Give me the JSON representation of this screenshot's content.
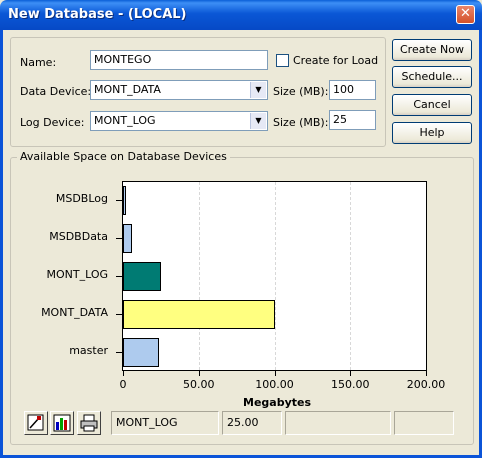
{
  "window": {
    "title": "New Database - (LOCAL)",
    "close_glyph": "✕"
  },
  "form": {
    "name_label": "Name:",
    "name_value": "MONTEGO",
    "create_for_load_label": "Create for Load",
    "create_for_load_checked": false,
    "data_device_label": "Data Device:",
    "data_device_value": "MONT_DATA",
    "log_device_label": "Log Device:",
    "log_device_value": "MONT_LOG",
    "size_label": "Size (MB):",
    "data_size_value": "100",
    "log_size_value": "25"
  },
  "buttons": {
    "create_now": "Create Now",
    "schedule": "Schedule...",
    "cancel": "Cancel",
    "help": "Help"
  },
  "available_space": {
    "title": "Available Space on Database Devices"
  },
  "chart_data": {
    "type": "bar",
    "orientation": "horizontal",
    "categories": [
      "MSDBLog",
      "MSDBData",
      "MONT_LOG",
      "MONT_DATA",
      "master"
    ],
    "values": [
      2,
      6,
      25,
      100,
      24
    ],
    "bar_colors": [
      "#aecbee",
      "#aecbee",
      "#007b73",
      "#ffff80",
      "#aecbee"
    ],
    "xlabel": "Megabytes",
    "xlim": [
      0,
      200
    ],
    "xticks": [
      "0",
      "50.00",
      "100.00",
      "150.00",
      "200.00"
    ],
    "grid": true
  },
  "status": {
    "device": "MONT_LOG",
    "size": "25.00"
  },
  "toolbar_icons": [
    "chart-properties-icon",
    "bar-chart-icon",
    "print-icon"
  ]
}
